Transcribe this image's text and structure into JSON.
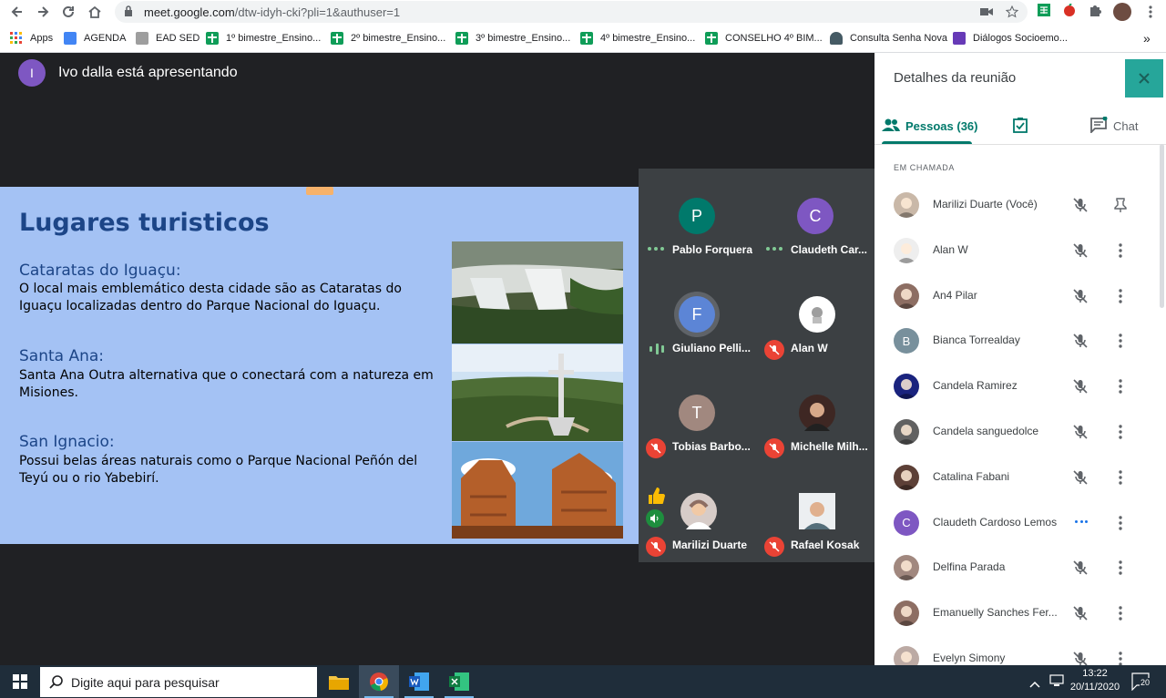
{
  "browser": {
    "url": "meet.google.com",
    "url_rest": "/dtw-idyh-cki?pli=1&authuser=1",
    "bookmarks": [
      {
        "label": "Apps"
      },
      {
        "label": "AGENDA"
      },
      {
        "label": "EAD SED"
      },
      {
        "label": "1º bimestre_Ensino..."
      },
      {
        "label": "2º bimestre_Ensino..."
      },
      {
        "label": "3º bimestre_Ensino..."
      },
      {
        "label": "4º bimestre_Ensino..."
      },
      {
        "label": "CONSELHO 4º BIM..."
      },
      {
        "label": "Consulta Senha Nova"
      },
      {
        "label": "Diálogos Socioemo..."
      }
    ],
    "more_bookmarks": "»"
  },
  "meet": {
    "presenter_initial": "I",
    "presenter_text": "Ivo dalla está apresentando",
    "slide": {
      "title": "Lugares turisticos",
      "sections": [
        {
          "heading": "Cataratas do Iguaçu:",
          "body": "O local mais emblemático desta cidade são as Cataratas do Iguaçu localizadas dentro do Parque Nacional do Iguaçu."
        },
        {
          "heading": "Santa Ana:",
          "body": "Santa Ana Outra alternativa que o conectará com a natureza em Misiones."
        },
        {
          "heading": "San Ignacio:",
          "body": "Possui belas áreas naturais como o Parque Nacional Peñón del Teyú ou o rio Yabebirí."
        }
      ]
    },
    "tiles": [
      {
        "name": "Pablo Forquera",
        "initial": "P",
        "color": "#00796b",
        "status": "talking-dots"
      },
      {
        "name": "Claudeth Car...",
        "initial": "C",
        "color": "#7e57c2",
        "status": "talking-dots"
      },
      {
        "name": "Giuliano Pelli...",
        "initial": "F",
        "color": "#5c85d6",
        "status": "speaking"
      },
      {
        "name": "Alan W",
        "initial": "",
        "color": "#ffffff",
        "status": "muted"
      },
      {
        "name": "Tobias Barbo...",
        "initial": "T",
        "color": "#a1887f",
        "status": "muted"
      },
      {
        "name": "Michelle Milh...",
        "initial": "",
        "color": "#3e2723",
        "status": "muted"
      },
      {
        "name": "Marilizi Duarte",
        "initial": "",
        "color": "#d7ccc8",
        "status": "muted"
      },
      {
        "name": "Rafael Kosak",
        "initial": "",
        "color": "#bcaaa4",
        "status": "muted"
      }
    ]
  },
  "panel": {
    "title": "Detalhes da reunião",
    "close_icon": "close-icon",
    "tabs": {
      "people": "Pessoas (36)",
      "chat": "Chat"
    },
    "section_label": "EM CHAMADA",
    "participants": [
      {
        "name": "Marilizi Duarte (Você)",
        "initial": "",
        "color": "#c9b8a8",
        "action": "pin"
      },
      {
        "name": "Alan W",
        "initial": "",
        "color": "#eeeeee",
        "action": "more"
      },
      {
        "name": "An4 Pilar",
        "initial": "",
        "color": "#8d6e63",
        "action": "more"
      },
      {
        "name": "Bianca Torrealday",
        "initial": "B",
        "color": "#78909c",
        "action": "more"
      },
      {
        "name": "Candela Ramirez",
        "initial": "",
        "color": "#1a237e",
        "action": "more"
      },
      {
        "name": "Candela sanguedolce",
        "initial": "",
        "color": "#616161",
        "action": "more"
      },
      {
        "name": "Catalina Fabani",
        "initial": "",
        "color": "#5d4037",
        "action": "more"
      },
      {
        "name": "Claudeth Cardoso Lemos",
        "initial": "C",
        "color": "#7e57c2",
        "action": "more"
      },
      {
        "name": "Delfina Parada",
        "initial": "",
        "color": "#a1887f",
        "action": "more"
      },
      {
        "name": "Emanuelly Sanches Fer...",
        "initial": "",
        "color": "#8d6e63",
        "action": "more"
      },
      {
        "name": "Evelyn Simony",
        "initial": "",
        "color": "#bcaaa4",
        "action": "more"
      }
    ]
  },
  "taskbar": {
    "search_placeholder": "Digite aqui para pesquisar",
    "time": "13:22",
    "date": "20/11/2020",
    "notification_count": "20"
  }
}
